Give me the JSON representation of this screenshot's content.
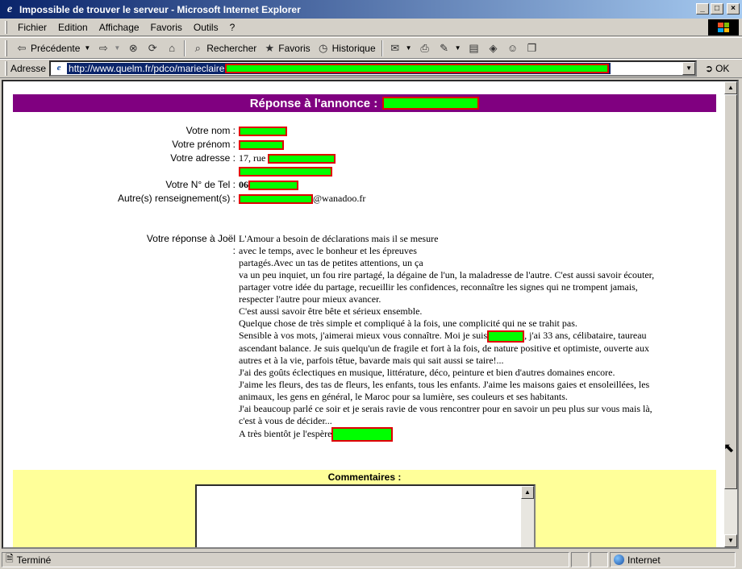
{
  "window": {
    "title": "Impossible de trouver le serveur - Microsoft Internet Explorer",
    "buttons": [
      "_",
      "□",
      "×"
    ]
  },
  "menubar": {
    "items": [
      "Fichier",
      "Edition",
      "Affichage",
      "Favoris",
      "Outils",
      "?"
    ]
  },
  "toolbar": {
    "back_label": "Précédente",
    "search_label": "Rechercher",
    "favorites_label": "Favoris",
    "history_label": "Historique"
  },
  "address": {
    "label": "Adresse",
    "url": "http://www.quelm.fr/pdco/marieclaire",
    "go_label": "OK"
  },
  "page": {
    "banner_title": "Réponse à l'annonce :",
    "fields": {
      "name_label": "Votre nom :",
      "firstname_label": "Votre prénom :",
      "address_label": "Votre adresse :",
      "address_value": "17, rue",
      "phone_label": "Votre N° de Tel :",
      "phone_value": "06",
      "other_label": "Autre(s) renseignement(s) :",
      "other_value": "@wanadoo.fr"
    },
    "reply_label": "Votre réponse à Joël :",
    "reply_text": [
      "L'Amour a besoin de déclarations mais il se mesure",
      "avec le temps, avec le bonheur et les épreuves",
      "partagés.Avec un tas de petites attentions, un ça",
      "va un peu inquiet, un fou rire partagé, la dégaine de l'un, la maladresse de l'autre. C'est aussi savoir écouter,",
      "partager votre idée du partage, recueillir les confidences, reconnaître les signes qui ne trompent jamais,",
      "respecter l'autre pour mieux avancer.",
      "C'est aussi savoir être bête et sérieux ensemble.",
      "Quelque chose de très simple et compliqué à la fois, une complicité qui ne se trahit pas.",
      "Sensible à vos mots, j'aimerai mieux vous connaître. Moi je suis",
      ", j'ai 33 ans, célibataire, taureau",
      "ascendant balance. Je suis quelqu'un de fragile et fort à la fois, de nature positive et optimiste, ouverte aux",
      "autres et à la vie, parfois têtue, bavarde mais qui sait aussi se taire!...",
      "J'ai des goûts éclectiques en musique, littérature, déco, peinture et bien d'autres domaines encore.",
      "J'aime les fleurs, des tas de fleurs, les enfants, tous les enfants. J'aime les maisons gaies et ensoleillées, les",
      "animaux, les gens en général, le Maroc pour sa lumière, ses couleurs et ses habitants.",
      "J'ai beaucoup parlé ce soir et je serais ravie de vous rencontrer pour en savoir un peu plus sur vous mais là,",
      "c'est à vous de décider...",
      "A très bientôt je l'espère"
    ],
    "comments_title": "Commentaires :"
  },
  "status": {
    "text": "Terminé",
    "zone": "Internet"
  }
}
